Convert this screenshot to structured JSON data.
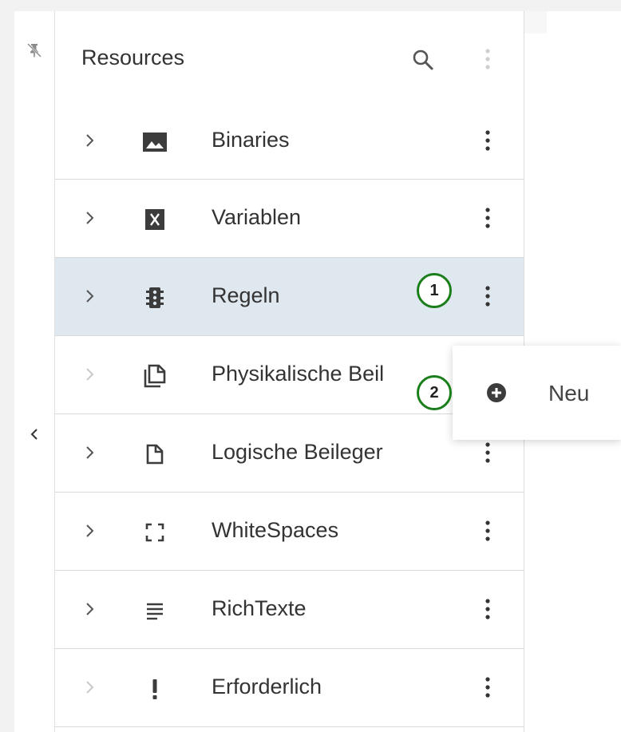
{
  "panel": {
    "title": "Resources",
    "search_icon": "search-icon",
    "more_icon": "more-vertical-icon"
  },
  "rail": {
    "pin_icon": "pin-off-icon",
    "collapse_icon": "chevron-left-icon"
  },
  "items": [
    {
      "label": "Binaries",
      "icon": "image-icon",
      "selected": false
    },
    {
      "label": "Variablen",
      "icon": "variable-icon",
      "selected": false
    },
    {
      "label": "Regeln",
      "icon": "traffic-light-icon",
      "selected": true
    },
    {
      "label": "Physikalische Beil",
      "icon": "copy-document-icon",
      "selected": false
    },
    {
      "label": "Logische Beileger",
      "icon": "document-icon",
      "selected": false
    },
    {
      "label": "WhiteSpaces",
      "icon": "frame-corners-icon",
      "selected": false
    },
    {
      "label": "RichTexte",
      "icon": "text-lines-icon",
      "selected": false
    },
    {
      "label": "Erforderlich",
      "icon": "exclamation-icon",
      "selected": false
    }
  ],
  "context_menu": {
    "items": [
      {
        "label": "Neu",
        "icon": "add-circle-icon"
      }
    ]
  },
  "callouts": [
    "1",
    "2"
  ],
  "colors": {
    "selected_row": "#dfe7ef",
    "callout_border": "#1a7f1a",
    "text": "#333333"
  }
}
